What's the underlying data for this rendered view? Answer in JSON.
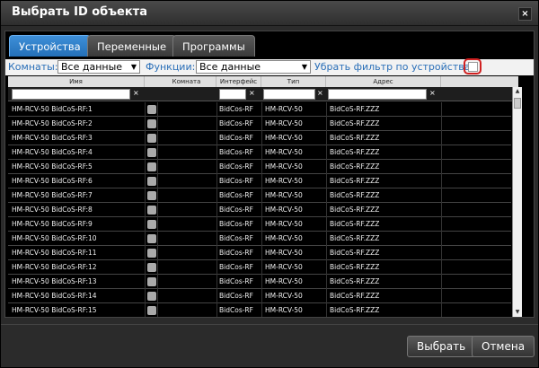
{
  "dialog": {
    "title": "Выбрать ID объекта",
    "close_label": "×"
  },
  "tabs": [
    {
      "label": "Устройства",
      "active": true
    },
    {
      "label": "Переменные",
      "active": false
    },
    {
      "label": "Программы",
      "active": false
    }
  ],
  "filters": {
    "rooms_label": "Комнаты:",
    "rooms_value": "Все данные",
    "functions_label": "Функции:",
    "functions_value": "Все данные",
    "remove_filter_label": "Убрать фильтр по устройствам",
    "remove_filter_checked": false
  },
  "grid": {
    "columns": [
      "Имя",
      "",
      "Комната",
      "Интерфейс",
      "Тип",
      "Адрес"
    ],
    "clear_label": "×",
    "rows": [
      {
        "name": "HM-RCV-50 BidCoS-RF:1",
        "room": "",
        "interface": "BidCos-RF",
        "type": "HM-RCV-50",
        "address": "BidCoS-RF.ZZZ"
      },
      {
        "name": "HM-RCV-50 BidCoS-RF:2",
        "room": "",
        "interface": "BidCos-RF",
        "type": "HM-RCV-50",
        "address": "BidCoS-RF.ZZZ"
      },
      {
        "name": "HM-RCV-50 BidCoS-RF:3",
        "room": "",
        "interface": "BidCos-RF",
        "type": "HM-RCV-50",
        "address": "BidCoS-RF.ZZZ"
      },
      {
        "name": "HM-RCV-50 BidCoS-RF:4",
        "room": "",
        "interface": "BidCos-RF",
        "type": "HM-RCV-50",
        "address": "BidCoS-RF.ZZZ"
      },
      {
        "name": "HM-RCV-50 BidCoS-RF:5",
        "room": "",
        "interface": "BidCos-RF",
        "type": "HM-RCV-50",
        "address": "BidCoS-RF.ZZZ"
      },
      {
        "name": "HM-RCV-50 BidCoS-RF:6",
        "room": "",
        "interface": "BidCos-RF",
        "type": "HM-RCV-50",
        "address": "BidCoS-RF.ZZZ"
      },
      {
        "name": "HM-RCV-50 BidCoS-RF:7",
        "room": "",
        "interface": "BidCos-RF",
        "type": "HM-RCV-50",
        "address": "BidCoS-RF.ZZZ"
      },
      {
        "name": "HM-RCV-50 BidCoS-RF:8",
        "room": "",
        "interface": "BidCos-RF",
        "type": "HM-RCV-50",
        "address": "BidCoS-RF.ZZZ"
      },
      {
        "name": "HM-RCV-50 BidCoS-RF:9",
        "room": "",
        "interface": "BidCos-RF",
        "type": "HM-RCV-50",
        "address": "BidCoS-RF.ZZZ"
      },
      {
        "name": "HM-RCV-50 BidCoS-RF:10",
        "room": "",
        "interface": "BidCos-RF",
        "type": "HM-RCV-50",
        "address": "BidCoS-RF.ZZZ"
      },
      {
        "name": "HM-RCV-50 BidCoS-RF:11",
        "room": "",
        "interface": "BidCos-RF",
        "type": "HM-RCV-50",
        "address": "BidCoS-RF.ZZZ"
      },
      {
        "name": "HM-RCV-50 BidCoS-RF:12",
        "room": "",
        "interface": "BidCos-RF",
        "type": "HM-RCV-50",
        "address": "BidCoS-RF.ZZZ"
      },
      {
        "name": "HM-RCV-50 BidCoS-RF:13",
        "room": "",
        "interface": "BidCos-RF",
        "type": "HM-RCV-50",
        "address": "BidCoS-RF.ZZZ"
      },
      {
        "name": "HM-RCV-50 BidCoS-RF:14",
        "room": "",
        "interface": "BidCos-RF",
        "type": "HM-RCV-50",
        "address": "BidCoS-RF.ZZZ"
      },
      {
        "name": "HM-RCV-50 BidCoS-RF:15",
        "room": "",
        "interface": "BidCos-RF",
        "type": "HM-RCV-50",
        "address": "BidCoS-RF.ZZZ"
      }
    ]
  },
  "footer": {
    "select_label": "Выбрать",
    "cancel_label": "Отмена"
  },
  "colors": {
    "active_tab": "#2f80cc",
    "annotation": "#d02020"
  }
}
